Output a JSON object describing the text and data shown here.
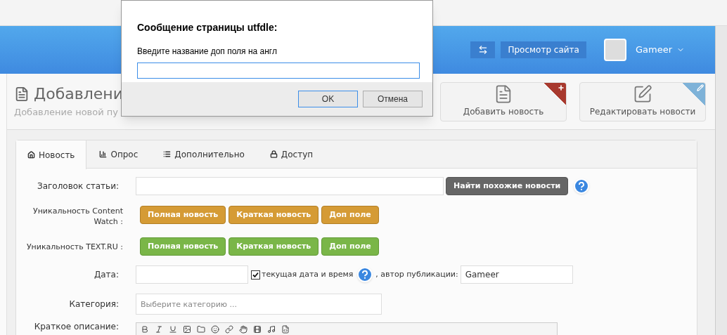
{
  "header": {
    "view_site_button": "Просмотр сайта",
    "user": {
      "name": "Gameer"
    }
  },
  "page": {
    "title": "Добавлени",
    "subtitle": "Добавление новой пу"
  },
  "quick_actions": [
    {
      "label": "Добавить новость",
      "kind": "add"
    },
    {
      "label": "Редактировать новости",
      "kind": "edit"
    }
  ],
  "tabs": [
    {
      "label": "Новость",
      "selected": true
    },
    {
      "label": "Опрос",
      "selected": false
    },
    {
      "label": "Дополнительно",
      "selected": false
    },
    {
      "label": "Доступ",
      "selected": false
    }
  ],
  "form": {
    "title_label": "Заголовок статьи:",
    "find_similar_button": "Найти похожие новости",
    "uniqueness_rows": [
      {
        "label": "Уникальность Content Watch :",
        "kind": "warning",
        "buttons": [
          "Полная новость",
          "Краткая новость",
          "Доп поле"
        ]
      },
      {
        "label": "Уникальность TEXT.RU :",
        "kind": "success",
        "buttons": [
          "Полная новость",
          "Краткая новость",
          "Доп поле"
        ]
      }
    ],
    "date_label": "Дата:",
    "current_date": {
      "label": "текущая дата и время",
      "checked": true
    },
    "author_label": ", автор публикации:",
    "author_value": "Gameer",
    "category_label": "Категория:",
    "category_placeholder": "Выберите категорию ...",
    "short_description_label": "Краткое описание:"
  },
  "dialog": {
    "title": "Сообщение страницы utfdle:",
    "message": "Введите название доп поля на англ",
    "ok_button": "OK",
    "cancel_button": "Отмена"
  }
}
